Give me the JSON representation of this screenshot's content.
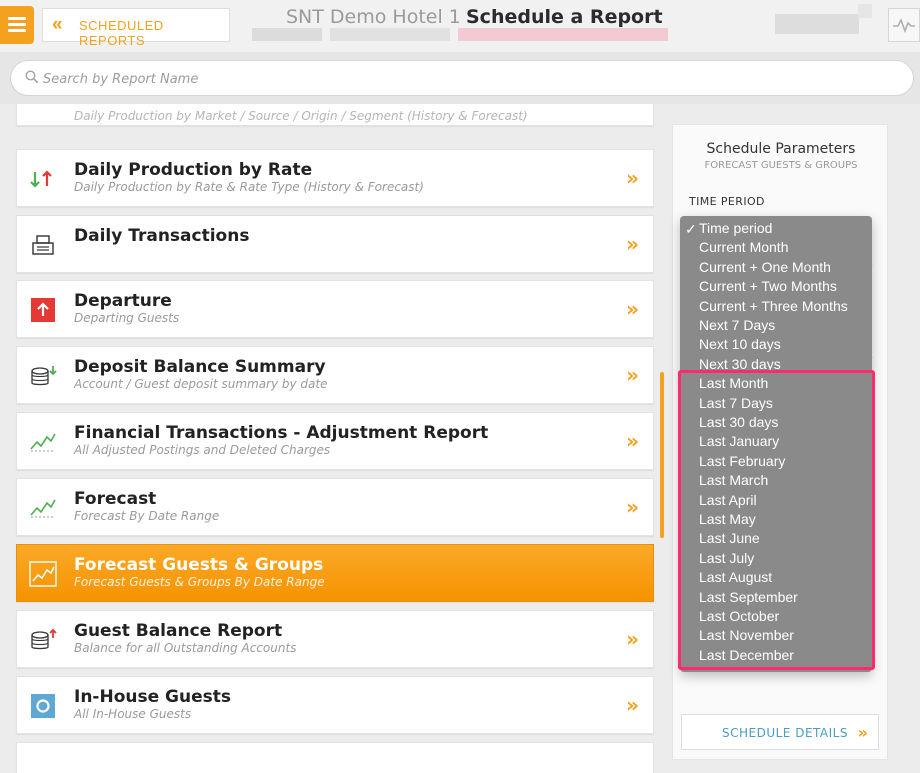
{
  "header": {
    "back_label": "SCHEDULED REPORTS",
    "hotel_name": "SNT Demo Hotel 1",
    "page_title": "Schedule a Report"
  },
  "search": {
    "placeholder": "Search by Report Name"
  },
  "reports": [
    {
      "title": "",
      "subtitle": "Daily Production by Market / Source / Origin / Segment (History & Forecast)",
      "icon": "chart-icon",
      "active": false
    },
    {
      "title": "Daily Production by Rate",
      "subtitle": "Daily Production by Rate & Rate Type (History & Forecast)",
      "icon": "up-down-arrows-icon",
      "active": false
    },
    {
      "title": "Daily Transactions",
      "subtitle": "",
      "icon": "cash-register-icon",
      "active": false
    },
    {
      "title": "Departure",
      "subtitle": "Departing Guests",
      "icon": "departure-arrow-icon",
      "active": false
    },
    {
      "title": "Deposit Balance Summary",
      "subtitle": "Account / Guest deposit summary by date",
      "icon": "coins-down-icon",
      "active": false
    },
    {
      "title": "Financial Transactions - Adjustment Report",
      "subtitle": "All Adjusted Postings and Deleted Charges",
      "icon": "trend-chart-icon",
      "active": false
    },
    {
      "title": "Forecast",
      "subtitle": "Forecast By Date Range",
      "icon": "trend-chart-icon",
      "active": false
    },
    {
      "title": "Forecast Guests & Groups",
      "subtitle": "Forecast Guests & Groups By Date Range",
      "icon": "trend-chart-icon",
      "active": true
    },
    {
      "title": "Guest Balance Report",
      "subtitle": "Balance for all Outstanding Accounts",
      "icon": "coins-up-icon",
      "active": false
    },
    {
      "title": "In-House Guests",
      "subtitle": "All In-House Guests",
      "icon": "in-house-icon",
      "active": false
    }
  ],
  "arrow_glyph": "»",
  "panel": {
    "title": "Schedule Parameters",
    "subtitle": "FORECAST GUESTS & GROUPS",
    "time_period_label": "TIME PERIOD",
    "schedule_details_label": "SCHEDULE DETAILS"
  },
  "dropdown": {
    "selected": "Time period",
    "check_glyph": "✓",
    "options": [
      "Time period",
      "Current Month",
      "Current + One Month",
      "Current + Two Months",
      "Current + Three Months",
      "Next 7 Days",
      "Next 10 days",
      "Next 30 days",
      "Last Month",
      "Last 7 Days",
      "Last 30 days",
      "Last January",
      "Last February",
      "Last March",
      "Last April",
      "Last May",
      "Last June",
      "Last July",
      "Last August",
      "Last September",
      "Last October",
      "Last November",
      "Last December"
    ]
  },
  "colors": {
    "accent": "#f4a11f",
    "highlight": "#ff2a6d",
    "link": "#4a9dc3"
  }
}
